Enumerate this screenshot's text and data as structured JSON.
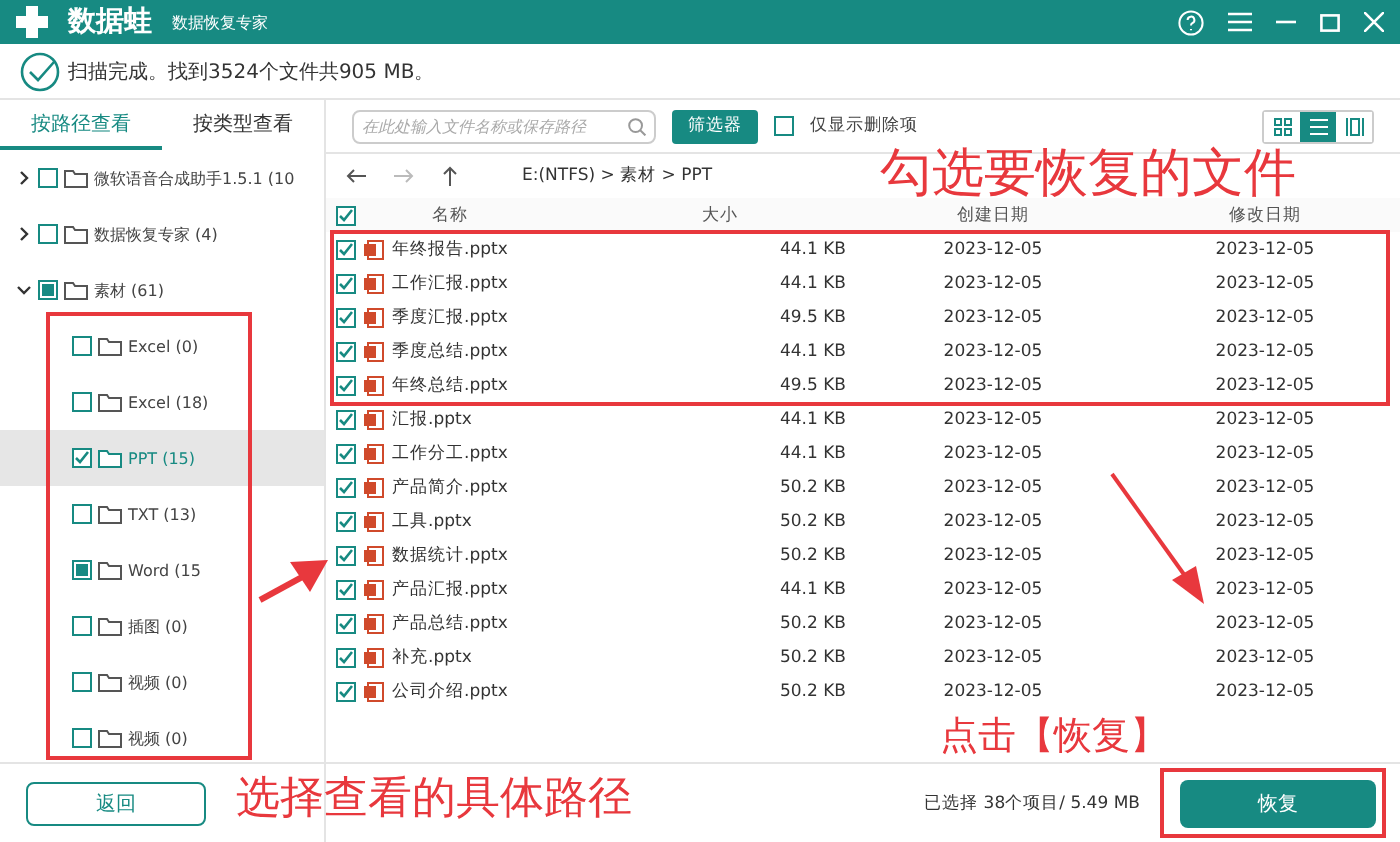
{
  "window": {
    "app_name": "数据蛙",
    "subtitle": "数据恢复专家"
  },
  "scan_status": "扫描完成。找到3524个文件共905 MB。",
  "tabs": [
    {
      "label": "按路径查看",
      "selected": true
    },
    {
      "label": "按类型查看",
      "selected": false
    }
  ],
  "tree": [
    {
      "label": "微软语音合成助手1.5.1 (10",
      "checked": false,
      "partial": false,
      "expanded": false,
      "selected": false
    },
    {
      "label": "数据恢复专家 (4)",
      "checked": false,
      "partial": false,
      "expanded": false,
      "selected": false
    },
    {
      "label": "素材 (61)",
      "checked": false,
      "partial": true,
      "expanded": true,
      "selected": false,
      "children": [
        {
          "label": "Excel (0)",
          "checked": false,
          "partial": false,
          "selected": false
        },
        {
          "label": "Excel (18)",
          "checked": false,
          "partial": false,
          "selected": false
        },
        {
          "label": "PPT (15)",
          "checked": true,
          "partial": false,
          "selected": true
        },
        {
          "label": "TXT (13)",
          "checked": false,
          "partial": false,
          "selected": false
        },
        {
          "label": "Word (15",
          "checked": false,
          "partial": true,
          "selected": false
        },
        {
          "label": "插图 (0)",
          "checked": false,
          "partial": false,
          "selected": false
        },
        {
          "label": "视频 (0)",
          "checked": false,
          "partial": false,
          "selected": false
        },
        {
          "label": "视频 (0)",
          "checked": false,
          "partial": false,
          "selected": false
        }
      ]
    }
  ],
  "back_button": "返回",
  "search": {
    "placeholder": "在此处输入文件名称或保存路径"
  },
  "filter_button": "筛选器",
  "deleted_only": {
    "label": "仅显示删除项",
    "checked": false
  },
  "views": [
    {
      "kind": "grid",
      "selected": false
    },
    {
      "kind": "list",
      "selected": true
    },
    {
      "kind": "preview",
      "selected": false
    }
  ],
  "path": "E:(NTFS) > 素材 > PPT",
  "table": {
    "all_checked": true,
    "columns": [
      "名称",
      "大小",
      "创建日期",
      "修改日期"
    ],
    "rows": [
      {
        "name": "年终报告.pptx",
        "size": "44.1 KB",
        "created": "2023-12-05",
        "modified": "2023-12-05",
        "checked": true
      },
      {
        "name": "工作汇报.pptx",
        "size": "44.1 KB",
        "created": "2023-12-05",
        "modified": "2023-12-05",
        "checked": true
      },
      {
        "name": "季度汇报.pptx",
        "size": "49.5 KB",
        "created": "2023-12-05",
        "modified": "2023-12-05",
        "checked": true
      },
      {
        "name": "季度总结.pptx",
        "size": "44.1 KB",
        "created": "2023-12-05",
        "modified": "2023-12-05",
        "checked": true
      },
      {
        "name": "年终总结.pptx",
        "size": "49.5 KB",
        "created": "2023-12-05",
        "modified": "2023-12-05",
        "checked": true
      },
      {
        "name": "汇报.pptx",
        "size": "44.1 KB",
        "created": "2023-12-05",
        "modified": "2023-12-05",
        "checked": true
      },
      {
        "name": "工作分工.pptx",
        "size": "44.1 KB",
        "created": "2023-12-05",
        "modified": "2023-12-05",
        "checked": true
      },
      {
        "name": "产品简介.pptx",
        "size": "50.2 KB",
        "created": "2023-12-05",
        "modified": "2023-12-05",
        "checked": true
      },
      {
        "name": "工具.pptx",
        "size": "50.2 KB",
        "created": "2023-12-05",
        "modified": "2023-12-05",
        "checked": true
      },
      {
        "name": "数据统计.pptx",
        "size": "50.2 KB",
        "created": "2023-12-05",
        "modified": "2023-12-05",
        "checked": true
      },
      {
        "name": "产品汇报.pptx",
        "size": "44.1 KB",
        "created": "2023-12-05",
        "modified": "2023-12-05",
        "checked": true
      },
      {
        "name": "产品总结.pptx",
        "size": "50.2 KB",
        "created": "2023-12-05",
        "modified": "2023-12-05",
        "checked": true
      },
      {
        "name": "补充.pptx",
        "size": "50.2 KB",
        "created": "2023-12-05",
        "modified": "2023-12-05",
        "checked": true
      },
      {
        "name": "公司介绍.pptx",
        "size": "50.2 KB",
        "created": "2023-12-05",
        "modified": "2023-12-05",
        "checked": true
      }
    ]
  },
  "selection_summary": "已选择 38个项目/ 5.49 MB",
  "recover_button": "恢复",
  "annotations": [
    "勾选要恢复的文件",
    "选择查看的具体路径",
    "点击【恢复】"
  ]
}
